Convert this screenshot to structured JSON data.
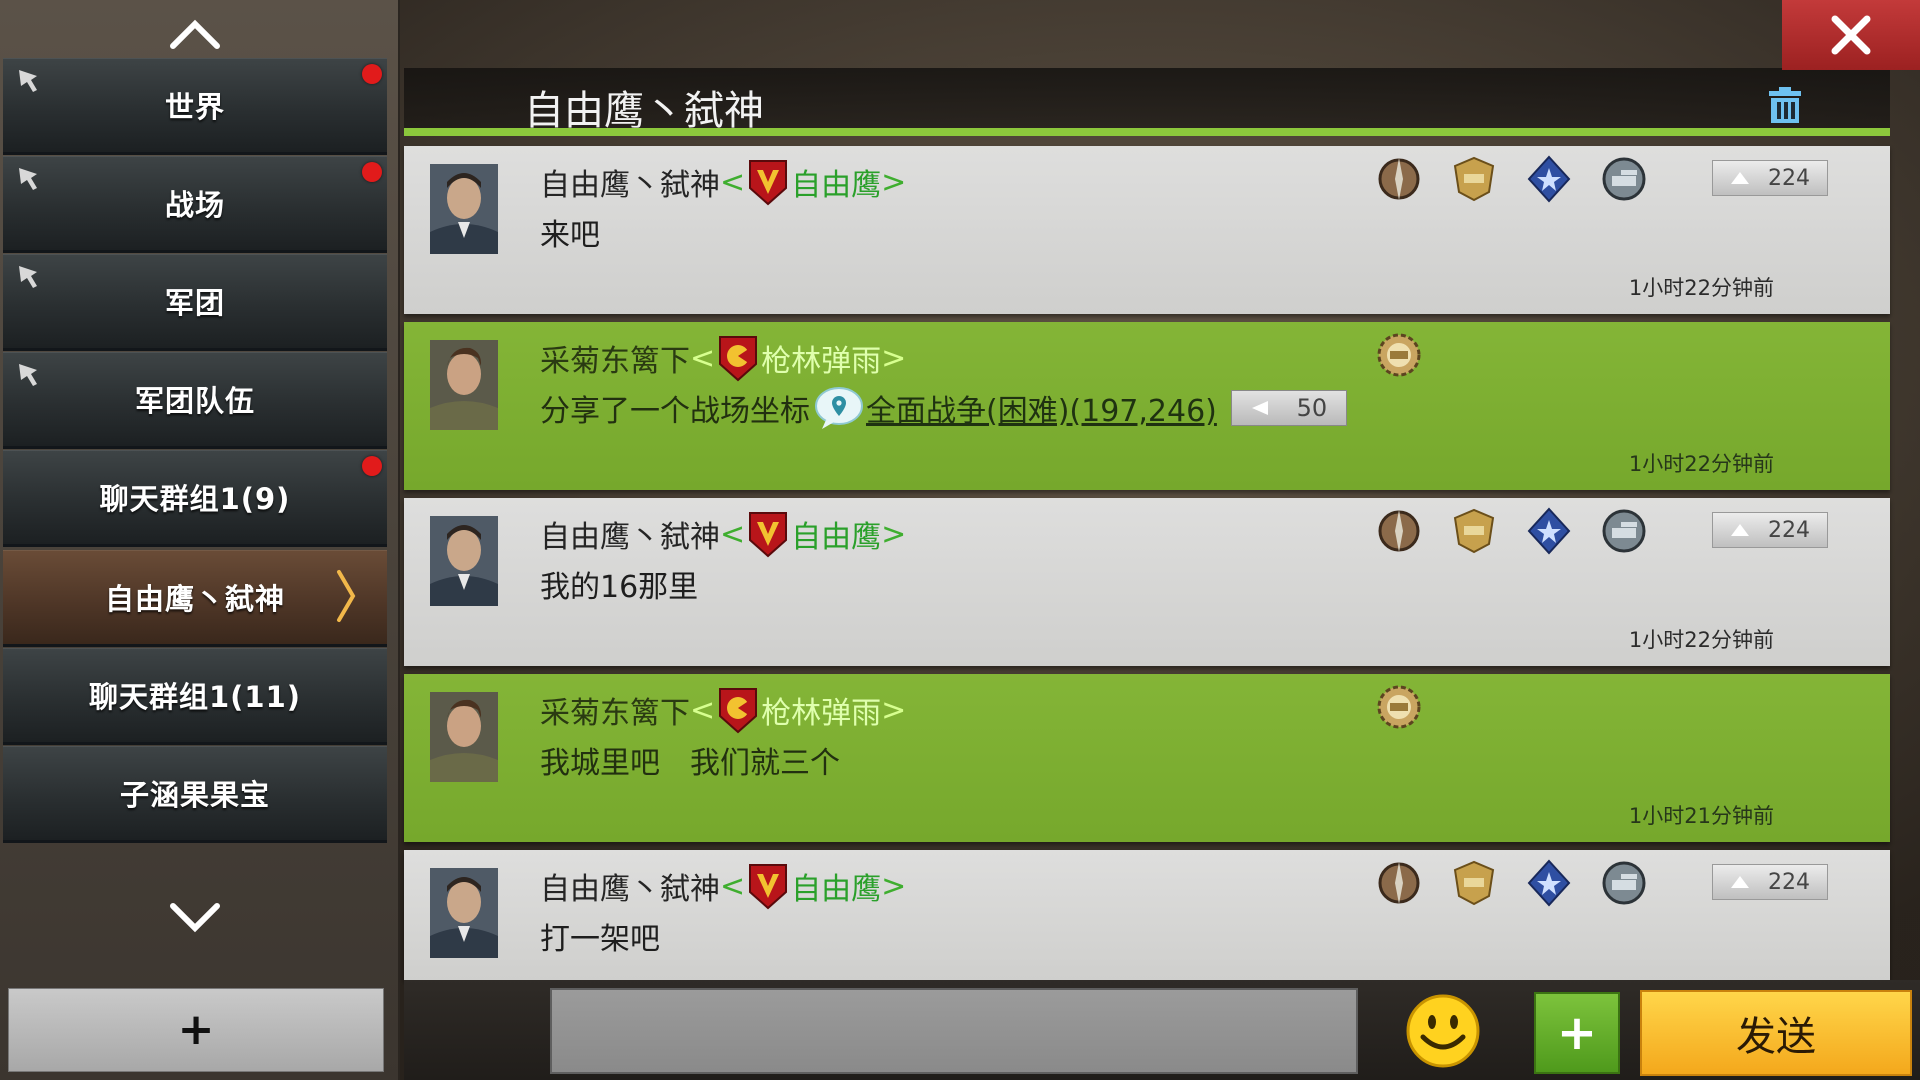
{
  "sidebar": {
    "items": [
      {
        "label": "世界",
        "pinned": true,
        "unread": true
      },
      {
        "label": "战场",
        "pinned": true,
        "unread": true
      },
      {
        "label": "军团",
        "pinned": true,
        "unread": false
      },
      {
        "label": "军团队伍",
        "pinned": true,
        "unread": false
      },
      {
        "label": "聊天群组1(9)",
        "pinned": false,
        "unread": true
      },
      {
        "label": "自由鹰丶弑神",
        "pinned": false,
        "unread": false,
        "active": true
      },
      {
        "label": "聊天群组1(11)",
        "pinned": false,
        "unread": false
      },
      {
        "label": "子涵果果宝",
        "pinned": false,
        "unread": false
      }
    ],
    "add_label": "+"
  },
  "header": {
    "title": "自由鹰丶弑神"
  },
  "messages": [
    {
      "sender": "自由鹰丶弑神",
      "open": "<",
      "guild": "自由鹰",
      "close": ">",
      "text": "来吧",
      "time": "1小时22分钟前",
      "level": "224",
      "style": "grey"
    },
    {
      "sender": "采菊东篱下",
      "open": "<",
      "guild": "枪林弹雨",
      "close": ">",
      "text": "分享了一个战场坐标",
      "link": "全面战争(困难)(197,246)",
      "sublevel": "50",
      "time": "1小时22分钟前",
      "style": "green"
    },
    {
      "sender": "自由鹰丶弑神",
      "open": "<",
      "guild": "自由鹰",
      "close": ">",
      "text": "我的16那里",
      "time": "1小时22分钟前",
      "level": "224",
      "style": "grey"
    },
    {
      "sender": "采菊东篱下",
      "open": "<",
      "guild": "枪林弹雨",
      "close": ">",
      "text": "我城里吧　我们就三个",
      "time": "1小时21分钟前",
      "style": "green"
    },
    {
      "sender": "自由鹰丶弑神",
      "open": "<",
      "guild": "自由鹰",
      "close": ">",
      "text": "打一架吧",
      "level": "224",
      "style": "grey"
    }
  ],
  "composer": {
    "input_value": "",
    "attach_label": "+",
    "send_label": "发送"
  },
  "colors": {
    "accent_green": "#8cc83c",
    "close_red": "#c33a3a",
    "send_yellow": "#f4a81c",
    "unread_red": "#e11b1b"
  }
}
